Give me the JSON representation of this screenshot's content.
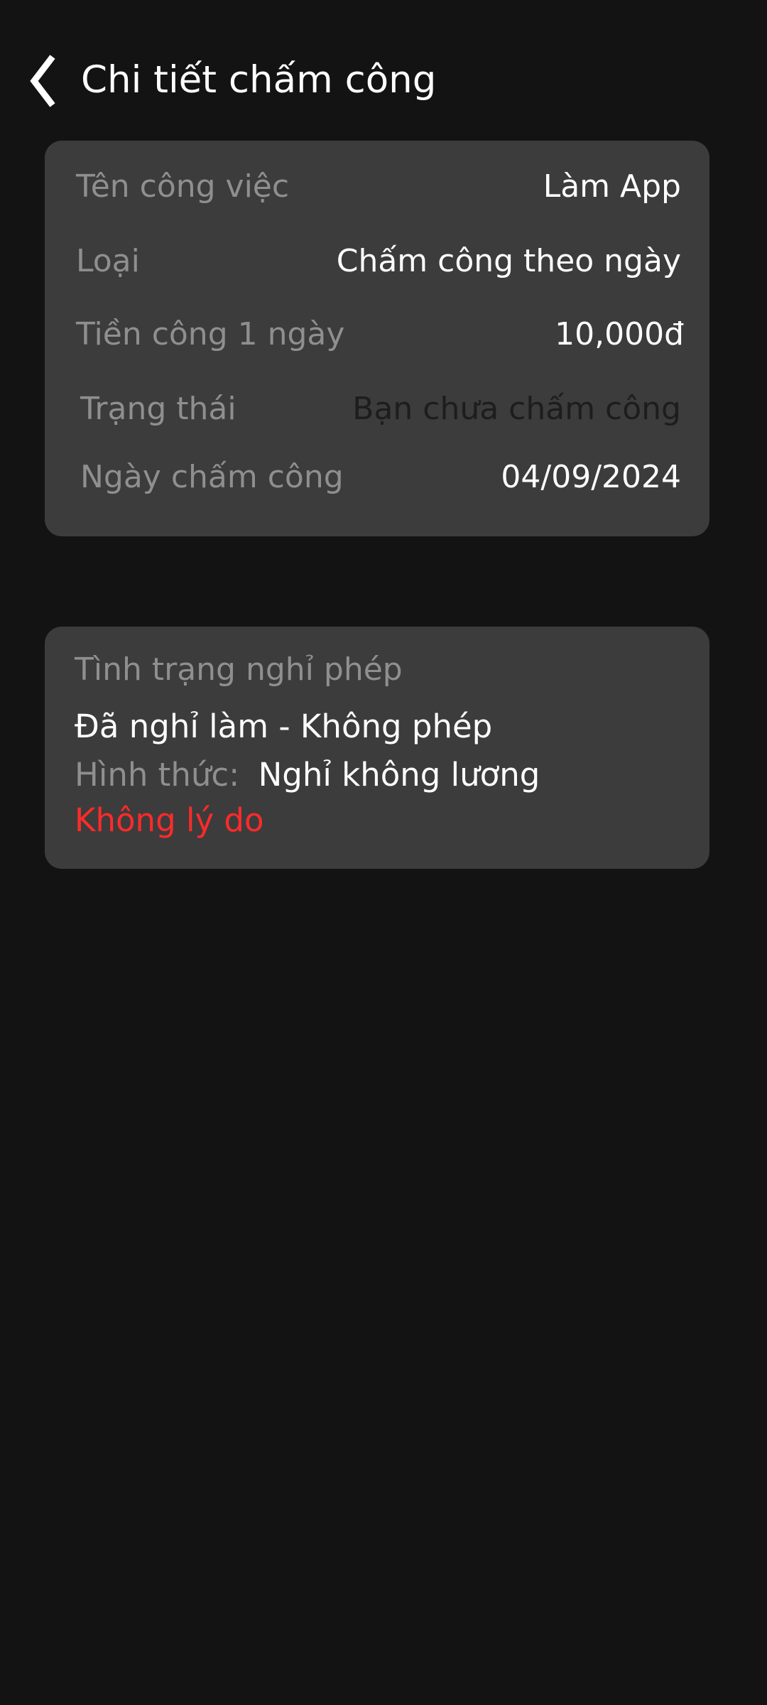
{
  "header": {
    "title": "Chi tiết chấm công",
    "back_icon": "chevron-left-icon"
  },
  "detail": {
    "rows": [
      {
        "label": "Tên công việc",
        "value": "Làm App"
      },
      {
        "label": "Loại",
        "value": "Chấm công theo ngày"
      },
      {
        "label": "Tiền công 1 ngày",
        "value": "10,000đ"
      },
      {
        "label": "Trạng thái",
        "value": "Bạn chưa chấm công"
      },
      {
        "label": "Ngày chấm công",
        "value": "04/09/2024"
      }
    ]
  },
  "leave": {
    "title": "Tình trạng nghỉ phép",
    "status": "Đã nghỉ làm - Không phép",
    "form_label": "Hình thức:",
    "form_value": "Nghỉ không lương",
    "reason": "Không lý do"
  },
  "colors": {
    "background": "#131313",
    "card": "#3c3c3c",
    "label": "#8f8f8f",
    "value": "#ffffff",
    "alert": "#ff2a2a"
  }
}
